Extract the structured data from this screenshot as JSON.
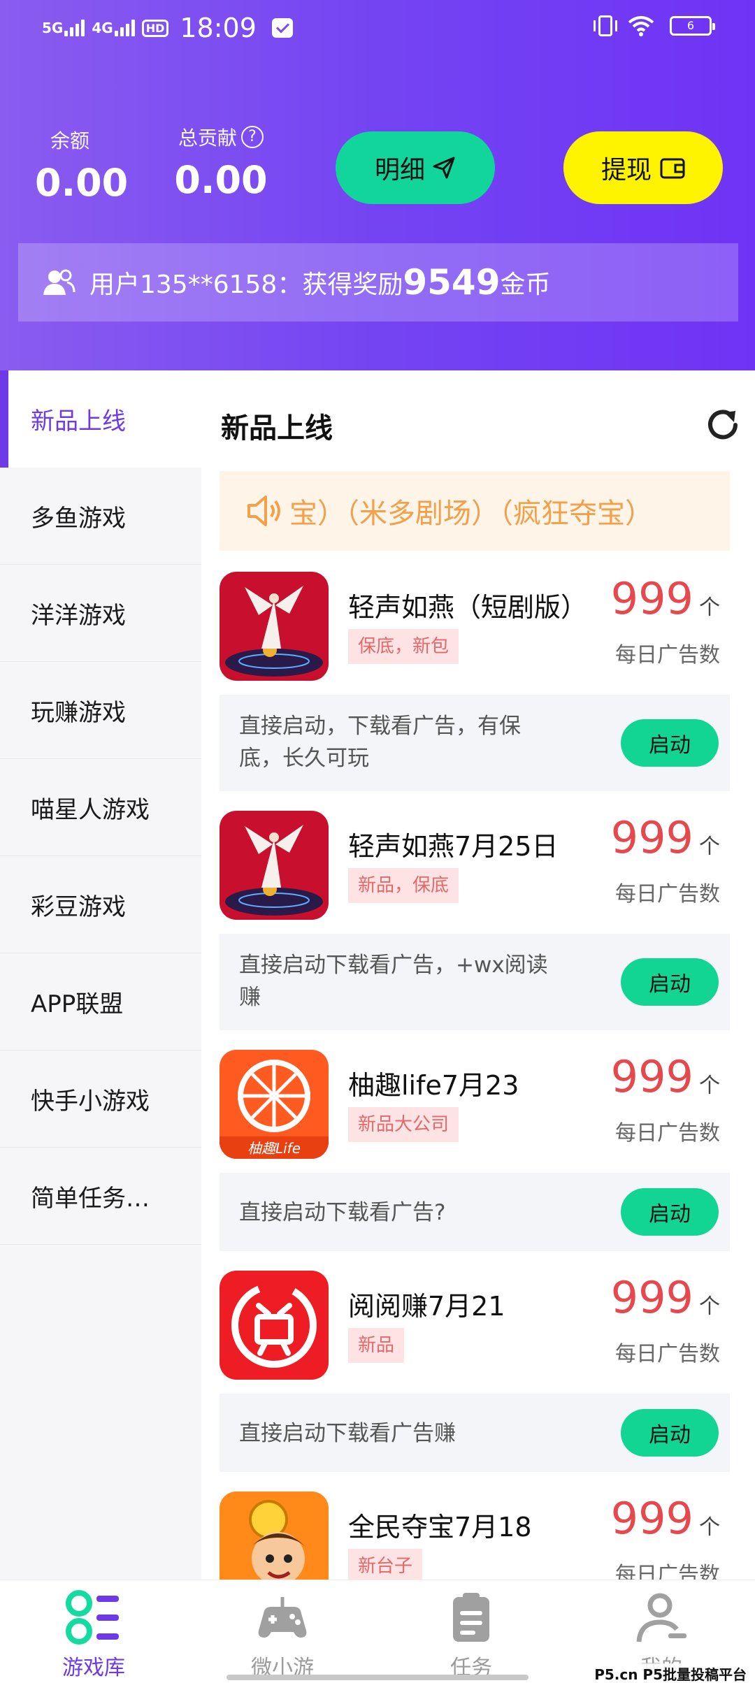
{
  "status_bar": {
    "net1": "5G",
    "net2": "4G",
    "hd": "HD",
    "time": "18:09",
    "battery": "6"
  },
  "header": {
    "balance_label": "余额",
    "balance_value": "0.00",
    "contribution_label": "总贡献",
    "contribution_value": "0.00",
    "detail_button": "明细",
    "withdraw_button": "提现",
    "notice_prefix": "用户135**6158：获得奖励",
    "notice_amount": "9549",
    "notice_suffix": "金币"
  },
  "sidebar": {
    "items": [
      {
        "label": "新品上线",
        "active": true
      },
      {
        "label": "多鱼游戏"
      },
      {
        "label": "洋洋游戏"
      },
      {
        "label": "玩赚游戏"
      },
      {
        "label": "喵星人游戏"
      },
      {
        "label": "彩豆游戏"
      },
      {
        "label": "APP联盟"
      },
      {
        "label": "快手小游戏"
      },
      {
        "label": "简单任务…"
      }
    ]
  },
  "main": {
    "title": "新品上线",
    "marquee": "宝）（米多剧场）（疯狂夺宝）",
    "cards": [
      {
        "name": "轻声如燕（短剧版）",
        "tag": "保底，新包",
        "count": "999",
        "unit": "个",
        "daily": "每日广告数",
        "desc_line1": "直接启动，下载看广告，有保",
        "desc_line2": "底，长久可玩",
        "button": "启动",
        "icon": "angel-app-icon"
      },
      {
        "name": "轻声如燕7月25日",
        "tag": "新品，保底",
        "count": "999",
        "unit": "个",
        "daily": "每日广告数",
        "desc_line1": "直接启动下载看广告，+wx阅读",
        "desc_line2": "赚",
        "button": "启动",
        "icon": "angel-app-icon"
      },
      {
        "name": "柚趣life7月23",
        "tag": "新品大公司",
        "count": "999",
        "unit": "个",
        "daily": "每日广告数",
        "desc_line1": "直接启动下载看广告?",
        "desc_line2": "",
        "button": "启动",
        "icon": "grapefruit-app-icon",
        "icon_text": "柚趣Life"
      },
      {
        "name": "阅阅赚7月21",
        "tag": "新品",
        "count": "999",
        "unit": "个",
        "daily": "每日广告数",
        "desc_line1": "直接启动下载看广告赚",
        "desc_line2": "",
        "button": "启动",
        "icon": "yueyuezhuan-app-icon"
      },
      {
        "name": "全民夺宝7月18",
        "tag": "新台子",
        "count": "999",
        "unit": "个",
        "daily": "每日广告数",
        "icon": "cartoon-app-icon"
      }
    ]
  },
  "bottom_nav": [
    {
      "label": "游戏库",
      "active": true
    },
    {
      "label": "微小游"
    },
    {
      "label": "任务"
    },
    {
      "label": "我的"
    }
  ],
  "watermark": "P5.cn P5批量投稿平台",
  "colors": {
    "primary": "#6e3ae8",
    "accent_green": "#12d594",
    "accent_yellow": "#fff400",
    "count_red": "#e5484d"
  }
}
